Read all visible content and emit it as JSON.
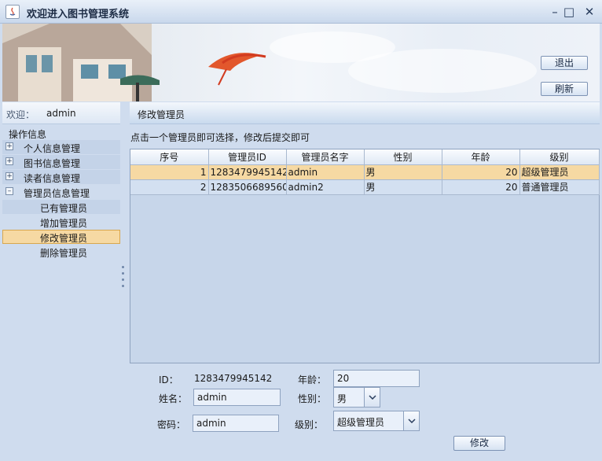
{
  "window": {
    "title": "欢迎进入图书管理系统",
    "minimize": "–",
    "maximize": "□",
    "close": "✕"
  },
  "header": {
    "exit_label": "退出",
    "refresh_label": "刷新"
  },
  "sidebar": {
    "welcome_label": "欢迎：",
    "username": "admin",
    "section_title": "操作信息",
    "items": [
      {
        "label": "个人信息管理",
        "expander": "+"
      },
      {
        "label": "图书信息管理",
        "expander": "+"
      },
      {
        "label": "读者信息管理",
        "expander": "+"
      },
      {
        "label": "管理员信息管理",
        "expander": "–"
      }
    ],
    "subitems": [
      {
        "label": "已有管理员"
      },
      {
        "label": "增加管理员"
      },
      {
        "label": "修改管理员"
      },
      {
        "label": "删除管理员"
      }
    ]
  },
  "main": {
    "panel_title": "修改管理员",
    "instruction": "点击一个管理员即可选择，修改后提交即可",
    "table": {
      "columns": [
        "序号",
        "管理员ID",
        "管理员名字",
        "性别",
        "年龄",
        "级别"
      ],
      "rows": [
        [
          "1",
          "1283479945142",
          "admin",
          "男",
          "20",
          "超级管理员"
        ],
        [
          "2",
          "1283506689560",
          "admin2",
          "男",
          "20",
          "普通管理员"
        ]
      ]
    }
  },
  "form": {
    "id_label": "ID：",
    "id_value": "1283479945142",
    "age_label": "年龄：",
    "age_value": "20",
    "name_label": "姓名：",
    "name_value": "admin",
    "gender_label": "性别：",
    "gender_value": "男",
    "password_label": "密码：",
    "password_value": "admin",
    "level_label": "级别：",
    "level_value": "超级管理员",
    "submit_label": "修改"
  },
  "colors": {
    "selected_row": "#f6d9a3",
    "panel_bg": "#cfdcee"
  }
}
